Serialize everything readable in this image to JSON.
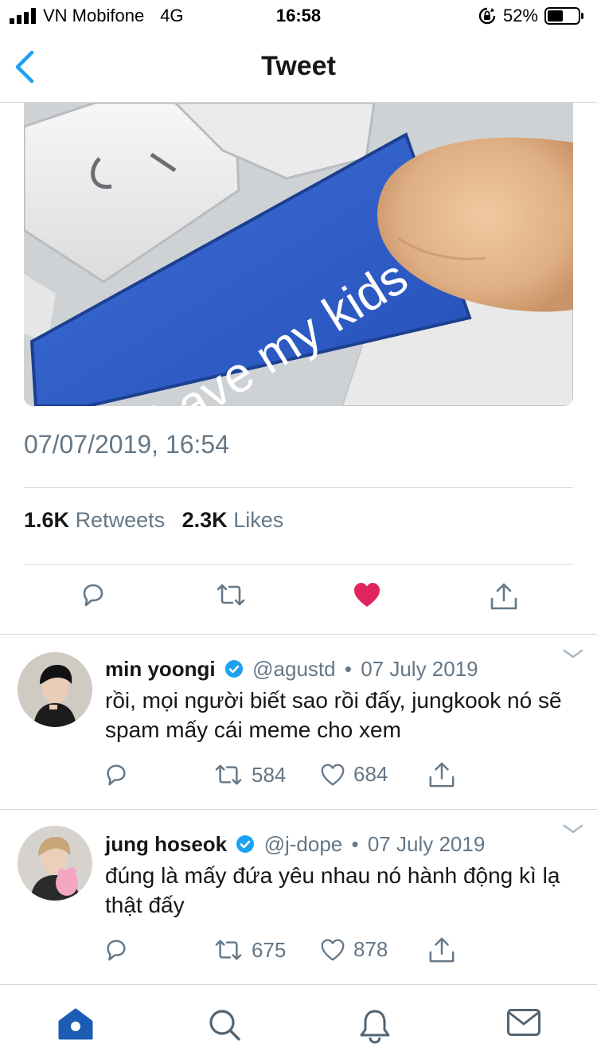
{
  "status_bar": {
    "carrier": "VN Mobifone",
    "network": "4G",
    "time": "16:58",
    "battery": "52%",
    "battery_level": 0.52
  },
  "header": {
    "title": "Tweet"
  },
  "tweet": {
    "meme_text": "have my kids",
    "timestamp": "07/07/2019, 16:54",
    "retweets_count": "1.6K",
    "retweets_label": "Retweets",
    "likes_count": "2.3K",
    "likes_label": "Likes",
    "liked": true,
    "like_color": "#e0245e"
  },
  "replies": [
    {
      "name": "min yoongi",
      "handle": "@agustd",
      "separator": "•",
      "date": "07 July 2019",
      "text": "rồi, mọi người biết sao rồi đấy, jungkook nó sẽ spam mấy cái meme cho xem",
      "retweets": "584",
      "likes": "684"
    },
    {
      "name": "jung hoseok",
      "handle": "@j-dope",
      "separator": "•",
      "date": "07 July 2019",
      "text": "đúng là mấy đứa yêu nhau nó hành động kì lạ thật đấy",
      "retweets": "675",
      "likes": "878"
    }
  ],
  "tab_bar": {
    "items": [
      "home-icon",
      "search-icon",
      "bell-icon",
      "mail-icon"
    ],
    "active": "home-icon"
  },
  "colors": {
    "accent": "#1da1f2",
    "muted": "#657786",
    "text": "#14171a",
    "tab_active": "#1b5cb5"
  }
}
